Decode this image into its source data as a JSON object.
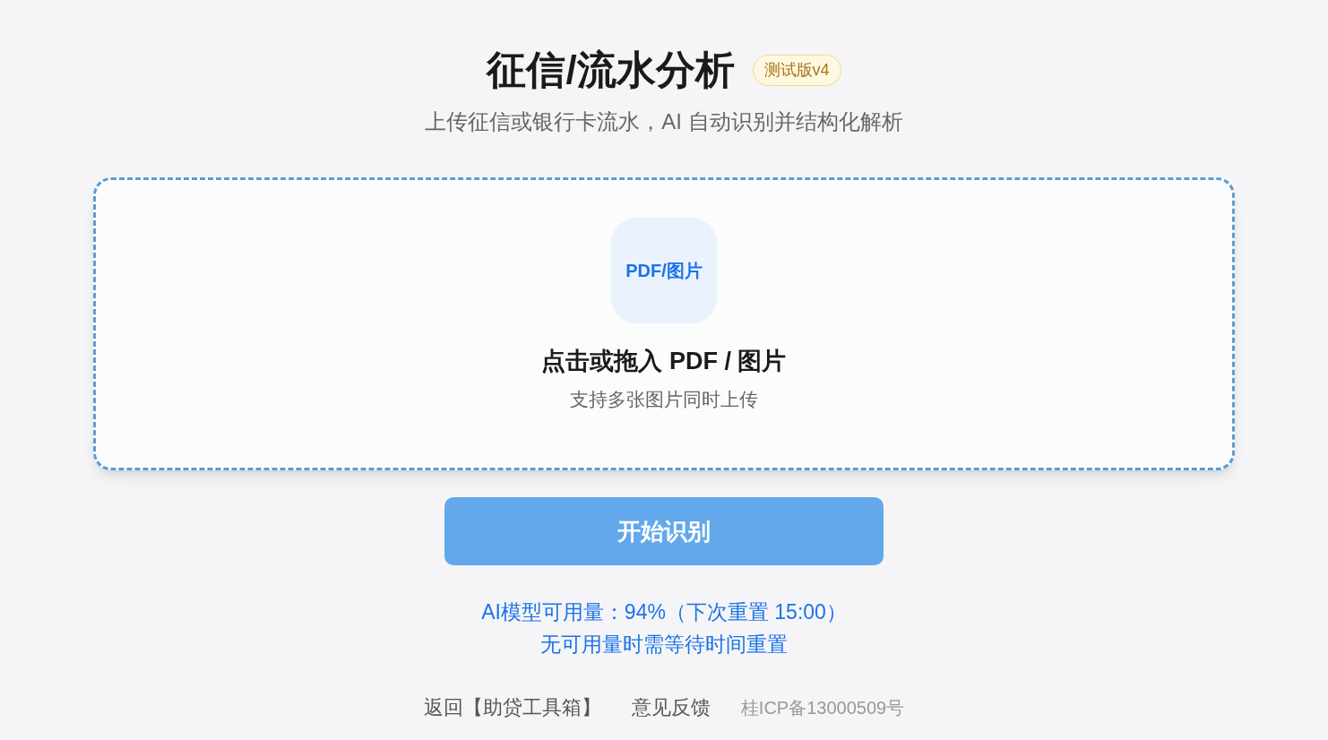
{
  "header": {
    "title": "征信/流水分析",
    "badge": "测试版v4",
    "subtitle": "上传征信或银行卡流水，AI 自动识别并结构化解析"
  },
  "upload": {
    "icon_label": "PDF/图片",
    "prompt": "点击或拖入 PDF / 图片",
    "hint": "支持多张图片同时上传"
  },
  "start_button": {
    "label": "开始识别",
    "disabled": true
  },
  "usage": [
    "AI模型可用量：94%（下次重置 15:00）",
    "无可用量时需等待时间重置"
  ],
  "footer": {
    "links": [
      "返回【助贷工具箱】",
      "意见反馈"
    ],
    "icp": "桂ICP备13000509号"
  }
}
